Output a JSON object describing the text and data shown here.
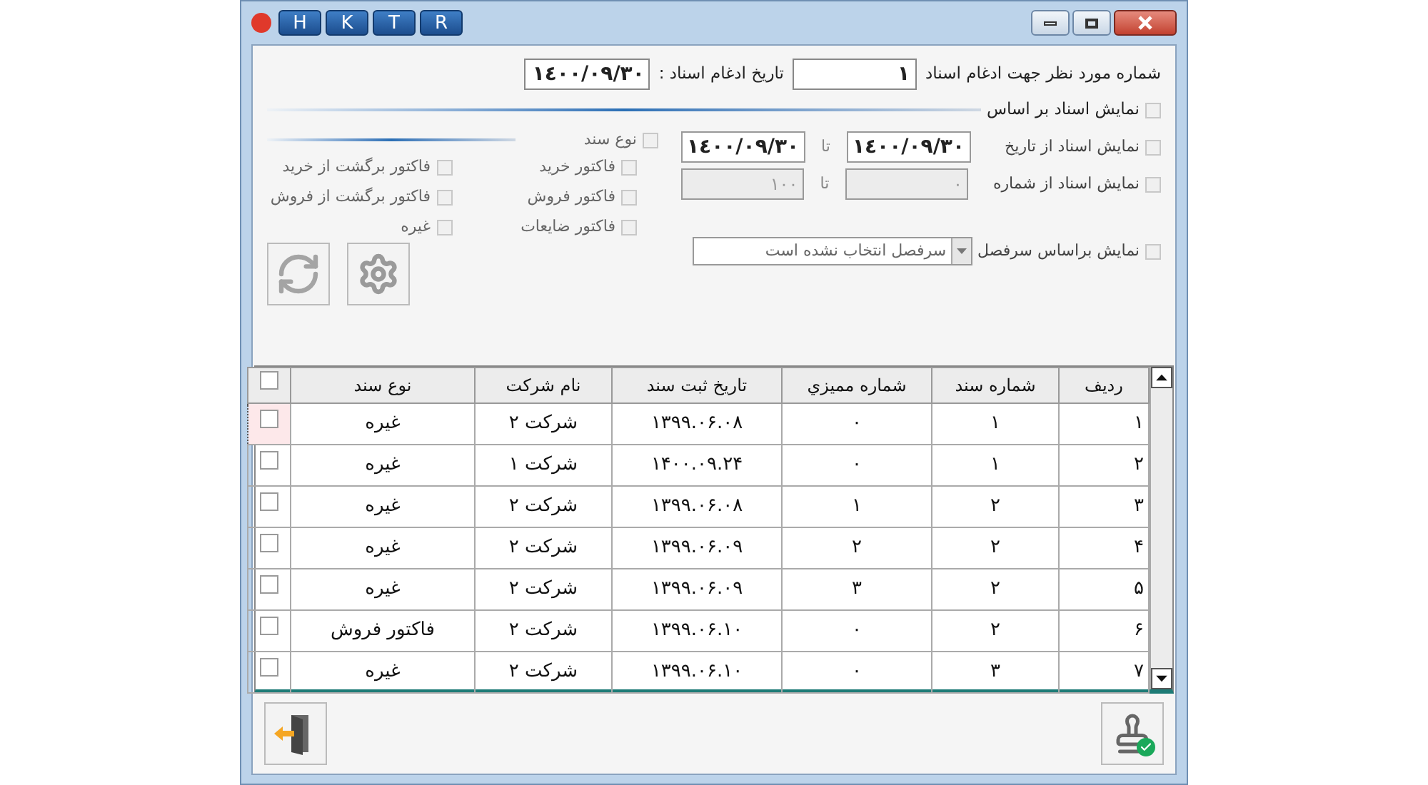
{
  "window": {
    "title_buttons": [
      "R",
      "T",
      "K",
      "H"
    ]
  },
  "merge": {
    "number_label": "شماره مورد نظر جهت ادغام اسناد",
    "number_value": "١",
    "date_label": "تاریخ ادغام اسناد :",
    "date_value": "١٤٠٠/٠٩/٣٠"
  },
  "filter": {
    "label": "نمایش اسناد بر اساس",
    "checked": false
  },
  "ranges": [
    {
      "label": "نمایش اسناد از تاریخ",
      "checked": false,
      "from": "١٤٠٠/٠٩/٣٠",
      "to_label": "تا",
      "to": "١٤٠٠/٠٩/٣٠",
      "disabled": false
    },
    {
      "label": "نمایش اسناد از شماره",
      "checked": false,
      "from": "٠",
      "to_label": "تا",
      "to": "١٠٠",
      "disabled": true
    }
  ],
  "heading_filter": {
    "label": "نمایش براساس سرفصل",
    "checked": false,
    "value": "سرفصل انتخاب نشده است"
  },
  "doc_type": {
    "label": "نوع سند",
    "checked": false,
    "options": [
      {
        "label": "فاکتور خرید",
        "checked": false
      },
      {
        "label": "فاکتور برگشت از خرید",
        "checked": false
      },
      {
        "label": "فاکتور فروش",
        "checked": false
      },
      {
        "label": "فاکتور برگشت از فروش",
        "checked": false
      },
      {
        "label": "فاکتور ضایعات",
        "checked": false
      },
      {
        "label": "غیره",
        "checked": false
      }
    ]
  },
  "table": {
    "columns": [
      "ردیف",
      "شماره سند",
      "شماره مميزي",
      "تاریخ ثبت سند",
      "نام شرکت",
      "نوع سند"
    ],
    "all_checked": false,
    "rows": [
      {
        "cells": [
          "۱",
          "۱",
          "۰",
          "۱۳۹۹.۰۶.۰۸",
          "شرکت ۲",
          "غیره"
        ],
        "checked": false,
        "focused": true
      },
      {
        "cells": [
          "۲",
          "۱",
          "۰",
          "۱۴۰۰.۰۹.۲۴",
          "شرکت ۱",
          "غیره"
        ],
        "checked": false,
        "focused": false
      },
      {
        "cells": [
          "۳",
          "۲",
          "۱",
          "۱۳۹۹.۰۶.۰۸",
          "شرکت ۲",
          "غیره"
        ],
        "checked": false,
        "focused": false
      },
      {
        "cells": [
          "۴",
          "۲",
          "۲",
          "۱۳۹۹.۰۶.۰۹",
          "شرکت ۲",
          "غیره"
        ],
        "checked": false,
        "focused": false
      },
      {
        "cells": [
          "۵",
          "۲",
          "۳",
          "۱۳۹۹.۰۶.۰۹",
          "شرکت ۲",
          "غیره"
        ],
        "checked": false,
        "focused": false
      },
      {
        "cells": [
          "۶",
          "۲",
          "۰",
          "۱۳۹۹.۰۶.۱۰",
          "شرکت ۲",
          "فاکتور فروش"
        ],
        "checked": false,
        "focused": false
      },
      {
        "cells": [
          "۷",
          "۳",
          "۰",
          "۱۳۹۹.۰۶.۱۰",
          "شرکت ۲",
          "غیره"
        ],
        "checked": false,
        "focused": false
      }
    ]
  }
}
